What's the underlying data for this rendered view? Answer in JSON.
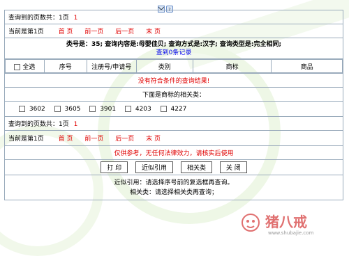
{
  "colors": {
    "accent_red": "#e00000",
    "link_blue": "#0000ee",
    "border": "#99aabb"
  },
  "top": {
    "count_label": "查询到的页数共：1页",
    "count_value": "1"
  },
  "nav": {
    "current": "当前是第1页",
    "first": "首 页",
    "prev": "前一页",
    "next": "后一页",
    "last": "末 页"
  },
  "query": {
    "summary": "类号是：35; 查询内容是:母婴佳贝; 查询方式是:汉字; 查询类型是:完全相同;",
    "records": "查到0条记录"
  },
  "table": {
    "select_all": "全选",
    "headers": [
      "序号",
      "注册号/申请号",
      "类别",
      "商标",
      "商品"
    ]
  },
  "no_result": "没有符合条件的查询结果!",
  "related_title": "下面是商标的相关类：",
  "related_classes": [
    "3602",
    "3605",
    "3901",
    "4203",
    "4227"
  ],
  "bottom": {
    "count_label": "查询到的页数共：1页",
    "count_value": "1",
    "current": "当前是第1页",
    "first": "首 页",
    "prev": "前一页",
    "next": "后一页",
    "last": "末 页"
  },
  "disclaimer": "仅供参考，无任何法律效力，请核实后使用",
  "buttons": {
    "print": "打 印",
    "similar": "近似引用",
    "related": "相关类",
    "close": "关 闭"
  },
  "notes": {
    "similar": "近似引用：请选择序号前的复选框再查询。",
    "related": "相关类：请选择相关类再查询；"
  },
  "watermark": {
    "brand": "猪八戒",
    "url": "www.shubajie.com"
  }
}
